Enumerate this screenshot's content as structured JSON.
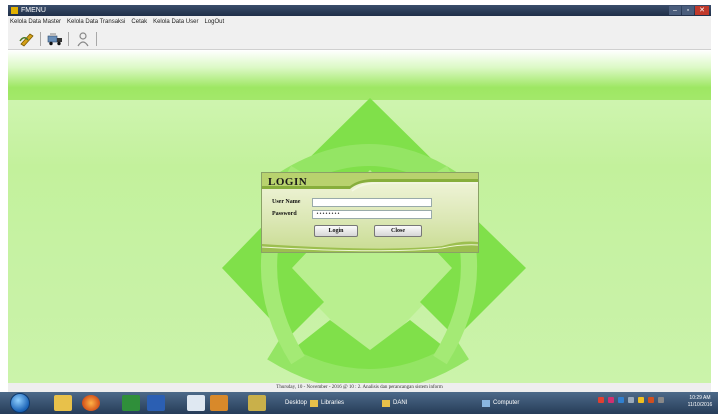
{
  "window": {
    "title": "FMENU",
    "controls": [
      "–",
      "▫",
      "✕"
    ]
  },
  "menu": [
    "Kelola Data Master",
    "Kelola Data Transaksi",
    "Cetak",
    "Kelola Data User",
    "LogOut"
  ],
  "toolbar": {
    "icons": [
      "edit-tool-icon",
      "truck-icon",
      "user-icon"
    ]
  },
  "login": {
    "title": "LOGIN",
    "username_label": "User Name",
    "username_value": "",
    "password_label": "Password",
    "password_value": "••••••••",
    "login_button": "Login",
    "close_button": "Close"
  },
  "status": {
    "text": "Thursday, 10 - November - 2016 @ 10 : 2. Analisis dan perancangan sistem inform"
  },
  "taskbar": {
    "desktop_label": "Desktop",
    "items": [
      "Libraries",
      "DANI",
      "Computer"
    ],
    "clock_time": "10:29 AM",
    "clock_date": "11/10/2016"
  },
  "colors": {
    "accent": "#9ee763",
    "background": "#c6f2a3",
    "logo": "#7fe04a",
    "title_bar": "#2c3e5a"
  }
}
